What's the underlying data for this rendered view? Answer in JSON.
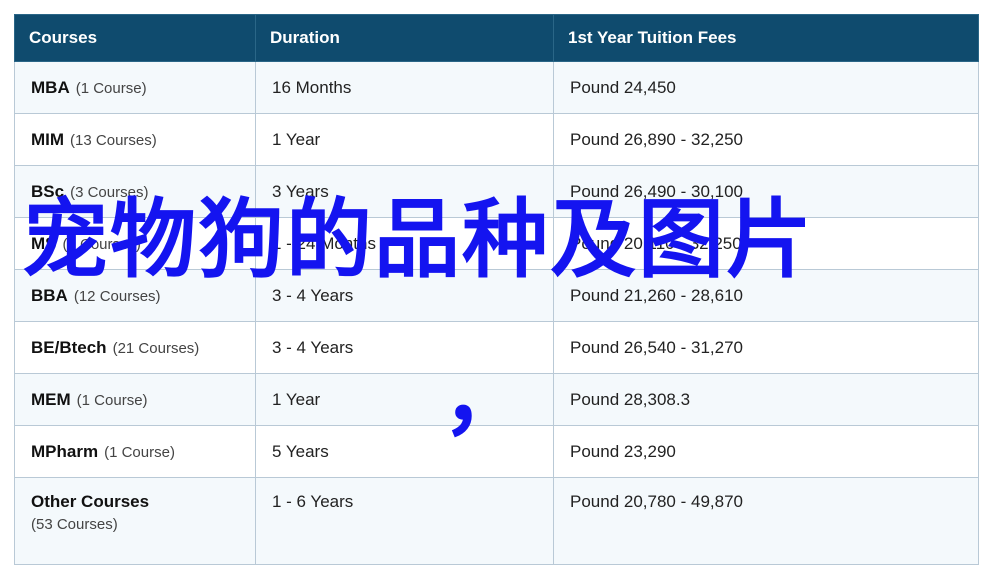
{
  "table": {
    "headers": [
      "Courses",
      "Duration",
      "1st Year Tuition Fees"
    ],
    "rows": [
      {
        "course": "MBA",
        "count": "(1 Course)",
        "duration": "16 Months",
        "fees": "Pound 24,450"
      },
      {
        "course": "MIM",
        "count": "(13 Courses)",
        "duration": "1 Year",
        "fees": "Pound 26,890 - 32,250"
      },
      {
        "course": "BSc",
        "count": "(3 Courses)",
        "duration": "3 Years",
        "fees": "Pound 26,490 - 30,100"
      },
      {
        "course": "MS",
        "count": "(5 Courses)",
        "duration": "1 - 24 Months",
        "fees": "Pound 20,110 - 32,250"
      },
      {
        "course": "BBA",
        "count": "(12 Courses)",
        "duration": "3 - 4 Years",
        "fees": "Pound 21,260 - 28,610"
      },
      {
        "course": "BE/Btech",
        "count": "(21 Courses)",
        "duration": "3 - 4 Years",
        "fees": "Pound 26,540 - 31,270"
      },
      {
        "course": "MEM",
        "count": "(1 Course)",
        "duration": "1 Year",
        "fees": "Pound 28,308.3"
      },
      {
        "course": "MPharm",
        "count": "(1 Course)",
        "duration": "5 Years",
        "fees": "Pound 23,290"
      },
      {
        "course": "Other Courses",
        "count": "(53 Courses)",
        "duration": "1 - 6 Years",
        "fees": "Pound 20,780 - 49,870"
      }
    ]
  },
  "overlay": {
    "headline": "宠物狗的品种及图片",
    "punctuation": "，",
    "color": "#1414f0"
  },
  "colors": {
    "header_bg": "#0f4b6e",
    "row_alt_bg": "#f4f9fc",
    "border": "#b9c9d6"
  }
}
